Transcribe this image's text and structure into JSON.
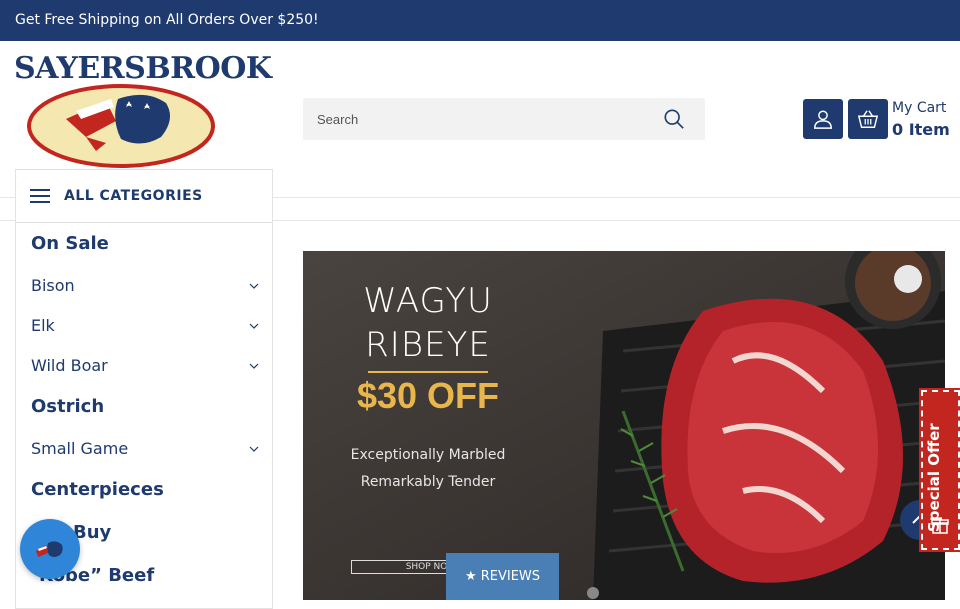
{
  "announcement": "Get Free Shipping on All Orders Over $250!",
  "logo": {
    "text_part1": "SAYERS",
    "text_part2": "BROOK"
  },
  "search": {
    "placeholder": "Search"
  },
  "cart": {
    "label": "My Cart",
    "count": "0 Item"
  },
  "categories": {
    "title": "ALL CATEGORIES",
    "items": [
      {
        "label": "On Sale",
        "has_children": false
      },
      {
        "label": "Bison",
        "has_children": true
      },
      {
        "label": "Elk",
        "has_children": true
      },
      {
        "label": "Wild Boar",
        "has_children": true
      },
      {
        "label": "Ostrich",
        "has_children": false
      },
      {
        "label": "Small Game",
        "has_children": true
      },
      {
        "label": "Centerpieces",
        "has_children": false
      },
      {
        "label": "Buy",
        "has_children": false
      },
      {
        "label": "Kobe” Beef",
        "has_children": false
      }
    ]
  },
  "banner": {
    "title_line1": "WAGYU",
    "title_line2": "RIBEYE",
    "offer": "$30 OFF",
    "sub_line1": "Exceptionally Marbled",
    "sub_line2": "Remarkably Tender",
    "cta": "SHOP NOW"
  },
  "reviews_tab": "★ REVIEWS",
  "special_offer": "Special Offer",
  "colors": {
    "brand": "#1e3a6e",
    "accent": "#e8b64a",
    "special": "#c2261e",
    "reviews": "#4a7fb6"
  }
}
